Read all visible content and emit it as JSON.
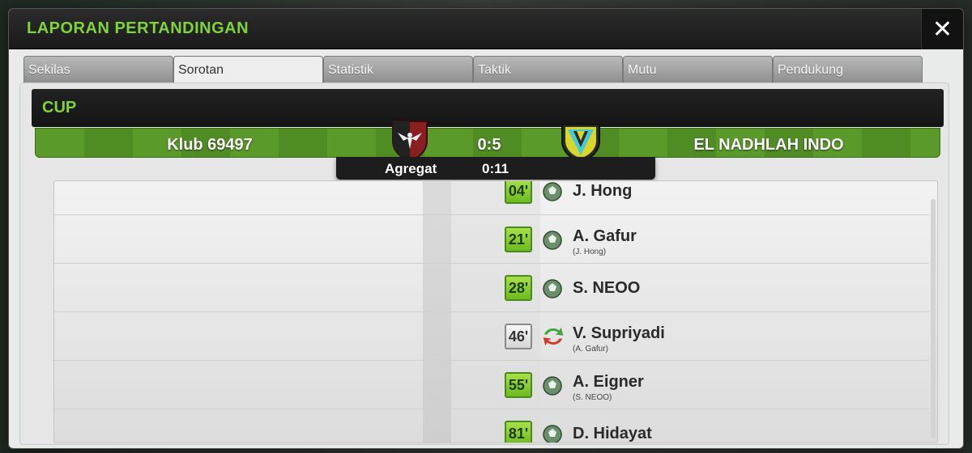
{
  "window": {
    "title": "LAPORAN PERTANDINGAN",
    "close_label": "✕"
  },
  "tabs": [
    {
      "label": "Sekilas",
      "active": false
    },
    {
      "label": "Sorotan",
      "active": true
    },
    {
      "label": "Statistik",
      "active": false
    },
    {
      "label": "Taktik",
      "active": false
    },
    {
      "label": "Mutu",
      "active": false
    },
    {
      "label": "Pendukung",
      "active": false
    }
  ],
  "competition": {
    "label": "CUP"
  },
  "match": {
    "home_team": "Klub 69497",
    "away_team": "EL NADHLAH INDO",
    "score": "0:5",
    "aggregate_label": "Agregat",
    "aggregate_score": "0:11",
    "home_crest_icon": "eagle-crest-icon",
    "away_crest_icon": "v-shield-crest-icon"
  },
  "colors": {
    "accent": "#7fd43a",
    "pitch": "#5a9a2a",
    "goal_minute": "#8ed236"
  },
  "events": [
    {
      "minute": "04'",
      "type": "goal",
      "icon": "ball-icon",
      "player": "J. Hong",
      "detail": ""
    },
    {
      "minute": "21'",
      "type": "goal",
      "icon": "ball-icon",
      "player": "A. Gafur",
      "detail": "(J. Hong)"
    },
    {
      "minute": "28'",
      "type": "goal",
      "icon": "ball-icon",
      "player": "S. NEOO",
      "detail": ""
    },
    {
      "minute": "46'",
      "type": "substitution",
      "icon": "substitution-arrows-icon",
      "player": "V. Supriyadi",
      "detail": "(A. Gafur)"
    },
    {
      "minute": "55'",
      "type": "goal",
      "icon": "ball-icon",
      "player": "A. Eigner",
      "detail": "(S. NEOO)"
    },
    {
      "minute": "81'",
      "type": "goal",
      "icon": "ball-icon",
      "player": "D. Hidayat",
      "detail": ""
    }
  ]
}
